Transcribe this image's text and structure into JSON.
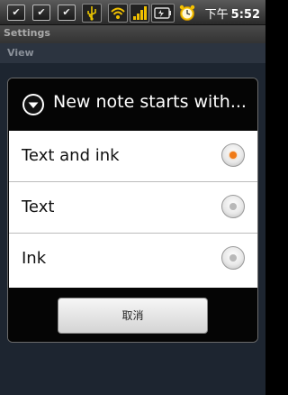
{
  "status_bar": {
    "time": "5:52",
    "ampm": "下午",
    "icons": [
      "checkbox-icon",
      "checkbox-icon",
      "checkbox-icon",
      "usb-icon",
      "wifi-icon",
      "signal-icon",
      "battery-icon",
      "alarm-icon"
    ]
  },
  "background": {
    "title": "Settings",
    "view_label": "View"
  },
  "dialog": {
    "title": "New note starts with...",
    "options": [
      {
        "label": "Text and ink",
        "selected": true
      },
      {
        "label": "Text",
        "selected": false
      },
      {
        "label": "Ink",
        "selected": false
      }
    ],
    "cancel_label": "取消"
  },
  "colors": {
    "accent": "#f07a16",
    "dialog_bg": "#050505"
  }
}
